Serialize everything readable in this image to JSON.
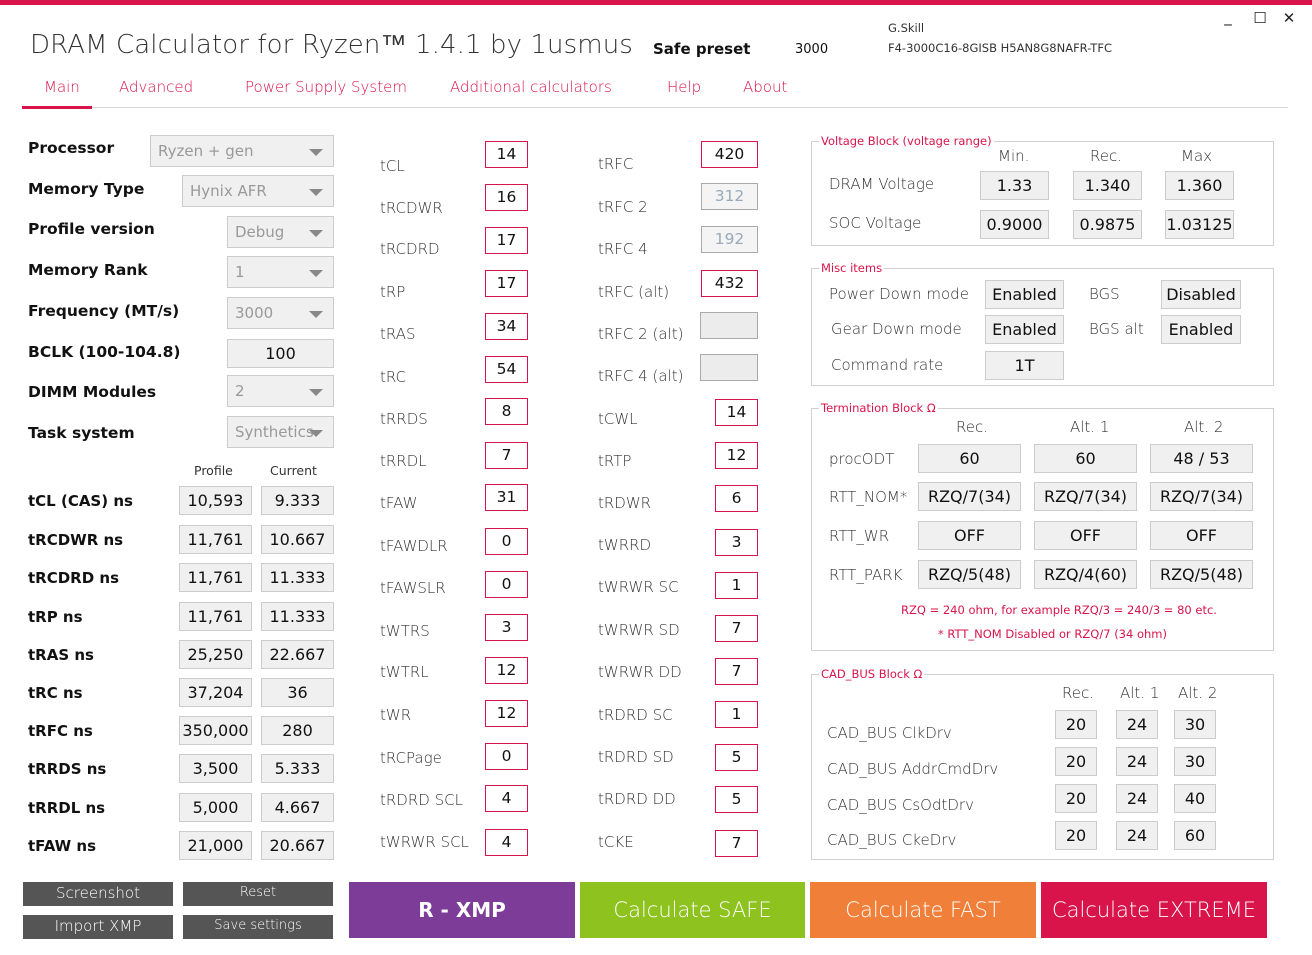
{
  "window": {
    "title": "DRAM Calculator for Ryzen™ 1.4.1 by 1usmus",
    "preset_label": "Safe preset",
    "preset_freq": "3000",
    "brand": "G.Skill",
    "part": "F4-3000C16-8GISB   H5AN8G8NAFR-TFC",
    "btn_min": "_",
    "btn_max": "☐",
    "btn_close": "✕"
  },
  "tabs": [
    "Main",
    "Advanced",
    "Power Supply System",
    "Additional calculators",
    "Help",
    "About"
  ],
  "settings": {
    "processor": {
      "label": "Processor",
      "value": "Ryzen + gen"
    },
    "memory_type": {
      "label": "Memory Type",
      "value": "Hynix AFR"
    },
    "profile_version": {
      "label": "Profile version",
      "value": "Debug"
    },
    "memory_rank": {
      "label": "Memory Rank",
      "value": "1"
    },
    "frequency": {
      "label": "Frequency (MT/s)",
      "value": "3000"
    },
    "bclk": {
      "label": "BCLK (100-104.8)",
      "value": "100"
    },
    "dimm": {
      "label": "DIMM Modules",
      "value": "2"
    },
    "task": {
      "label": "Task system",
      "value": "Synthetics"
    }
  },
  "ns_table": {
    "col_profile": "Profile",
    "col_current": "Current",
    "rows": [
      {
        "label": "tCL (CAS) ns",
        "profile": "10,593",
        "current": "9.333"
      },
      {
        "label": "tRCDWR ns",
        "profile": "11,761",
        "current": "10.667"
      },
      {
        "label": "tRCDRD ns",
        "profile": "11,761",
        "current": "11.333"
      },
      {
        "label": "tRP ns",
        "profile": "11,761",
        "current": "11.333"
      },
      {
        "label": "tRAS ns",
        "profile": "25,250",
        "current": "22.667"
      },
      {
        "label": "tRC ns",
        "profile": "37,204",
        "current": "36"
      },
      {
        "label": "tRFC ns",
        "profile": "350,000",
        "current": "280"
      },
      {
        "label": "tRRDS ns",
        "profile": "3,500",
        "current": "5.333"
      },
      {
        "label": "tRRDL ns",
        "profile": "5,000",
        "current": "4.667"
      },
      {
        "label": "tFAW ns",
        "profile": "21,000",
        "current": "20.667"
      }
    ]
  },
  "timings_a": [
    {
      "label": "tCL",
      "value": "14"
    },
    {
      "label": "tRCDWR",
      "value": "16"
    },
    {
      "label": "tRCDRD",
      "value": "17"
    },
    {
      "label": "tRP",
      "value": "17"
    },
    {
      "label": "tRAS",
      "value": "34"
    },
    {
      "label": "tRC",
      "value": "54"
    },
    {
      "label": "tRRDS",
      "value": "8"
    },
    {
      "label": "tRRDL",
      "value": "7"
    },
    {
      "label": "tFAW",
      "value": "31"
    },
    {
      "label": "tFAWDLR",
      "value": "0"
    },
    {
      "label": "tFAWSLR",
      "value": "0"
    },
    {
      "label": "tWTRS",
      "value": "3"
    },
    {
      "label": "tWTRL",
      "value": "12"
    },
    {
      "label": "tWR",
      "value": "12"
    },
    {
      "label": "tRCPage",
      "value": "0"
    },
    {
      "label": "tRDRD SCL",
      "value": "4"
    },
    {
      "label": "tWRWR SCL",
      "value": "4"
    }
  ],
  "timings_rfc": [
    {
      "label": "tRFC",
      "value": "420"
    },
    {
      "label": "tRFC 2",
      "value": "312"
    },
    {
      "label": "tRFC 4",
      "value": "192"
    },
    {
      "label": "tRFC (alt)",
      "value": "432"
    },
    {
      "label": "tRFC 2 (alt)",
      "value": ""
    },
    {
      "label": "tRFC 4 (alt)",
      "value": ""
    }
  ],
  "timings_b": [
    {
      "label": "tCWL",
      "value": "14"
    },
    {
      "label": "tRTP",
      "value": "12"
    },
    {
      "label": "tRDWR",
      "value": "6"
    },
    {
      "label": "tWRRD",
      "value": "3"
    },
    {
      "label": "tWRWR SC",
      "value": "1"
    },
    {
      "label": "tWRWR SD",
      "value": "7"
    },
    {
      "label": "tWRWR DD",
      "value": "7"
    },
    {
      "label": "tRDRD SC",
      "value": "1"
    },
    {
      "label": "tRDRD SD",
      "value": "5"
    },
    {
      "label": "tRDRD DD",
      "value": "5"
    },
    {
      "label": "tCKE",
      "value": "7"
    }
  ],
  "voltage": {
    "title": "Voltage Block (voltage range)",
    "cols": [
      "Min.",
      "Rec.",
      "Max"
    ],
    "dram_label": "DRAM Voltage",
    "dram": [
      "1.33",
      "1.340",
      "1.360"
    ],
    "soc_label": "SOC Voltage",
    "soc": [
      "0.9000",
      "0.9875",
      "1.03125"
    ]
  },
  "misc": {
    "title": "Misc items",
    "pdm_label": "Power Down mode",
    "pdm": "Enabled",
    "bgs_label": "BGS",
    "bgs": "Disabled",
    "gdm_label": "Gear Down mode",
    "gdm": "Enabled",
    "bgsalt_label": "BGS alt",
    "bgsalt": "Enabled",
    "cr_label": "Command rate",
    "cr": "1T"
  },
  "termination": {
    "title": "Termination Block Ω",
    "cols": [
      "Rec.",
      "Alt. 1",
      "Alt. 2"
    ],
    "rows": [
      {
        "label": "procODT",
        "values": [
          "60",
          "60",
          "48 / 53"
        ]
      },
      {
        "label": "RTT_NOM*",
        "values": [
          "RZQ/7(34)",
          "RZQ/7(34)",
          "RZQ/7(34)"
        ]
      },
      {
        "label": "RTT_WR",
        "values": [
          "OFF",
          "OFF",
          "OFF"
        ]
      },
      {
        "label": "RTT_PARK",
        "values": [
          "RZQ/5(48)",
          "RZQ/4(60)",
          "RZQ/5(48)"
        ]
      }
    ],
    "note1": "RZQ = 240 ohm, for example RZQ/3 = 240/3 = 80 etc.",
    "note2": "* RTT_NOM Disabled or RZQ/7 (34 ohm)"
  },
  "cad": {
    "title": "CAD_BUS Block Ω",
    "cols": [
      "Rec.",
      "Alt. 1",
      "Alt. 2"
    ],
    "rows": [
      {
        "label": "CAD_BUS ClkDrv",
        "values": [
          "20",
          "24",
          "30"
        ]
      },
      {
        "label": "CAD_BUS AddrCmdDrv",
        "values": [
          "20",
          "24",
          "30"
        ]
      },
      {
        "label": "CAD_BUS CsOdtDrv",
        "values": [
          "20",
          "24",
          "40"
        ]
      },
      {
        "label": "CAD_BUS CkeDrv",
        "values": [
          "20",
          "24",
          "60"
        ]
      }
    ]
  },
  "actions": {
    "screenshot": "Screenshot",
    "reset": "Reset",
    "import_xmp": "Import XMP",
    "save_settings": "Save settings",
    "rxmp": "R - XMP",
    "safe": "Calculate SAFE",
    "fast": "Calculate FAST",
    "extreme": "Calculate EXTREME"
  },
  "colors": {
    "accent": "#d8144a",
    "rxmp": "#7d3c98",
    "safe": "#8dc21f",
    "fast": "#f07f3a",
    "extreme": "#d8144a"
  }
}
